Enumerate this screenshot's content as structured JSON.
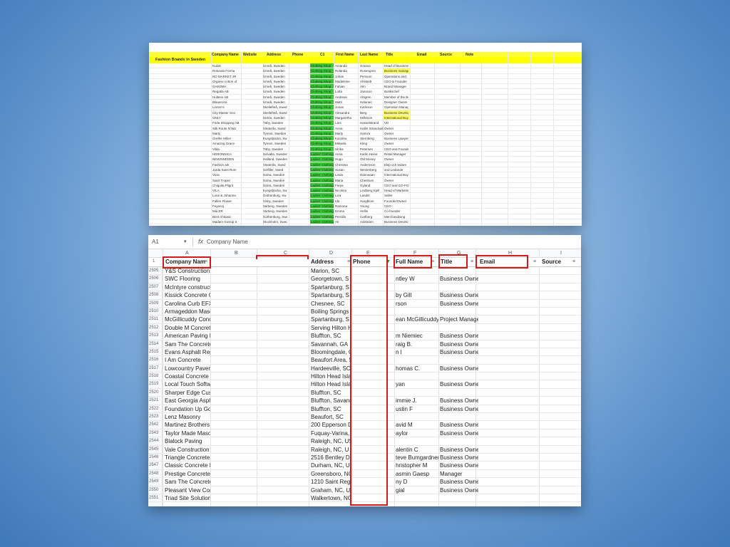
{
  "top_sheet": {
    "section_title": "Fashion Brands in Sweden",
    "headers": [
      "Company Name",
      "Website",
      "Address",
      "Phone",
      "C1",
      "First Name",
      "Last Name",
      "Title",
      "Email",
      "Source",
      "Note"
    ],
    "rows": [
      [
        "Isolde",
        "Umeå, Sweden",
        "Clothing Shop",
        "Amanda",
        "Granva",
        "Head of Business"
      ],
      [
        "Rotunda Forma",
        "Umeå, Sweden",
        "Clothing Shop",
        "Rolanda",
        "Rosengren",
        "Business manager"
      ],
      [
        "NO MARKET JR",
        "Umeå, Sweden",
        "Clothing Shop",
        "Johan",
        "Persson",
        "Operations and"
      ],
      [
        "Organic cotton of",
        "Umeå, Sweden",
        "Clothing Shop",
        "Madeleine",
        "Ahlstedt",
        "CEO & Founder"
      ],
      [
        "GAEDMA",
        "Umeå, Sweden",
        "Clothing Shop",
        "Fabian",
        "Alm",
        "Brand Manager"
      ],
      [
        "Regatta AB",
        "Umeå, Sweden",
        "Clothing Shop",
        "Lotta",
        "Jansson",
        "Butikschef"
      ],
      [
        "Hultens AB",
        "Umeå, Sweden",
        "Clothing Shop",
        "Andreas",
        "Ahlgren",
        "Member of the Board"
      ],
      [
        "Blanerona",
        "Umeå, Sweden",
        "Clothing Shop",
        "Matti",
        "Halunen",
        "Designer Owner"
      ],
      [
        "Linnen's",
        "Skellefteå, Swed",
        "Clothing Shop",
        "Jonas",
        "Karlsson",
        "Operation Manager"
      ],
      [
        "City Master Sno",
        "Skellefteå, Swed",
        "Clothing Shop",
        "Alexandra",
        "Berg",
        "Business Developer"
      ],
      [
        "ONLY",
        "Sickla, Sweden",
        "Clothing Shop",
        "Margaretha",
        "Millvison",
        "International Buyer"
      ],
      [
        "Frida Shopping AB",
        "Täby, Sweden",
        "Clothing Shop",
        "Lars",
        "Hasselstrand",
        "VD"
      ],
      [
        "Silk Route N Wa",
        "Västerås, Swed",
        "Clothing Shop",
        "Anna",
        "Hallin Strandvall",
        "Owner"
      ],
      [
        "Marty",
        "Tyresö, Sweden",
        "Clothing Shop",
        "Marty",
        "Hamza",
        "Owner"
      ],
      [
        "Grethe Hillier",
        "Kungsbacka, Sw",
        "Clothing Shop",
        "Karolina",
        "Sternberg",
        "Business Lawyer"
      ],
      [
        "Amazing Grace",
        "Tyresö, Sweden",
        "Clothing Shop",
        "Mikaela",
        "Kling",
        "Owner"
      ],
      [
        "Vilda",
        "Täby, Sweden",
        "Clothing Shop",
        "Ulrika",
        "Petersen",
        "CEO and Founder"
      ],
      [
        "HERONNICA",
        "Solvalla, Sweden",
        "Ladies' Clothing",
        "Anna",
        "Karlin Heine",
        "Retail Manager"
      ],
      [
        "NEWSWEDEN",
        "Halland, Sweden",
        "Ladies' Clothing",
        "Hugo",
        "Old Money",
        "Owner"
      ],
      [
        "Fashion ark",
        "Västerås, Swed",
        "Ladies' Clothing",
        "Christina",
        "Andersson",
        "Ekip och ledare"
      ],
      [
        "Jarda Saint Rom",
        "Solfiller, Swed",
        "Ladies' Clothing",
        "Susan",
        "Westerberg",
        "and Ledande"
      ],
      [
        "Vicia",
        "Solna, Sweden",
        "Ladies' Clothing",
        "Linda",
        "Danneaan",
        "International Buy"
      ],
      [
        "Saint Tropez",
        "Solna, Sweden",
        "Ladies' Clothing",
        "Maria",
        "Cheshum",
        "Owner"
      ],
      [
        "Chiquita Pligrit",
        "Solna, Sweden",
        "Ladies' Clothing",
        "Freya",
        "Gyland",
        "CEO and CO-FO"
      ],
      [
        "VILA",
        "Kungsbacka, Sw",
        "Ladies' Clothing",
        "Nicolina",
        "Lindberg Kjell",
        "Head of Marketing"
      ],
      [
        "Lone & Johanna",
        "Gothenburg, Sw",
        "Ladies' Clothing",
        "Liza",
        "Lander",
        "Seller"
      ],
      [
        "Fallen Flower",
        "Visby, Sweden",
        "Ladies' Clothing",
        "Ida",
        "Hargblom",
        "Founder/Owner"
      ],
      [
        "Feyenoj",
        "Varberg, Sweden",
        "Ladies' Clothing",
        "Ramona",
        "Young",
        "CEO"
      ],
      [
        "Mia ER",
        "Varberg, Sweden",
        "Ladies' Clothing",
        "Emma",
        "Hellin",
        "Co-founder"
      ],
      [
        "Best of Basic",
        "Gothenburg, Swed",
        "Ladies' Clothing",
        "Pernilla",
        "Carlberg",
        "Merchandising"
      ],
      [
        "Madam Gossip S",
        "Stockholm, Swed",
        "Ladies' Clothing",
        "Ali",
        "Adelstam",
        "Business Develo"
      ]
    ]
  },
  "formula_bar": {
    "cell_ref": "A1",
    "fx": "fx",
    "value": "Company Name"
  },
  "column_letters": [
    "A",
    "B",
    "C",
    "D",
    "E",
    "F",
    "G",
    "H",
    "I"
  ],
  "bottom_headers": {
    "company_name": "Company Nam",
    "address": "Address",
    "phone": "Phone",
    "full_name": "Full Name",
    "title": "Title",
    "email": "Email",
    "source": "Source"
  },
  "bottom_rows": [
    {
      "n": "2505",
      "company": "Y&S Construction",
      "address": "Marion, SC",
      "name": "",
      "title": ""
    },
    {
      "n": "2506",
      "company": "SWC Flooring",
      "address": "Georgetown, S",
      "name": "ntley W",
      "title": "Business Owner"
    },
    {
      "n": "2507",
      "company": "McIntyre construct",
      "address": "Spartanburg, S",
      "name": "",
      "title": ""
    },
    {
      "n": "2508",
      "company": "Kissick Concrete C",
      "address": "Spartanburg, S",
      "name": "by Gill",
      "title": "Business Owner"
    },
    {
      "n": "2509",
      "company": "Carolina Curb EFX",
      "address": "Chesnee, SC",
      "name": "rson",
      "title": "Business Owner"
    },
    {
      "n": "2510",
      "company": "Armageddon Maso",
      "address": "Boiling Springs",
      "name": "",
      "title": ""
    },
    {
      "n": "2511",
      "company": "McGillicuddy Concr",
      "address": "Spartanburg, S",
      "name": "ean McGillicuddy",
      "title": "Project Manager"
    },
    {
      "n": "2512",
      "company": "Double M Concrete",
      "address": "Serving Hilton H",
      "name": "",
      "title": ""
    },
    {
      "n": "2513",
      "company": "American Paving D",
      "address": "Bluffton, SC",
      "name": "m Niemiec",
      "title": "Business Owner"
    },
    {
      "n": "2514",
      "company": "Sam The Concrete",
      "address": "Savannah, GA",
      "name": "raig B.",
      "title": "Business Owner"
    },
    {
      "n": "2515",
      "company": "Evans Asphalt Rep",
      "address": "Bloomingdale, G",
      "name": "n l",
      "title": "Business Owner"
    },
    {
      "n": "2516",
      "company": "I Am Concrete",
      "address": "Beaufort Area, S",
      "name": "",
      "title": ""
    },
    {
      "n": "2517",
      "company": "Lowcountry Paver",
      "address": "Hardeeville, SC",
      "name": "homas C.",
      "title": "Business Owner"
    },
    {
      "n": "2518",
      "company": "Coastal Concrete F",
      "address": "Hilton Head Isla",
      "name": "",
      "title": ""
    },
    {
      "n": "2519",
      "company": "Local Touch Softw",
      "address": "Hilton Head Isla",
      "name": "yan",
      "title": "Business Owner"
    },
    {
      "n": "2520",
      "company": "Sharper Edge Cust",
      "address": "Bluffton, SC",
      "name": "",
      "title": ""
    },
    {
      "n": "2521",
      "company": "East Georgia Asph",
      "address": "Bluffton, Savann",
      "name": "immie J.",
      "title": "Business Owner"
    },
    {
      "n": "2522",
      "company": "Foundation Up Gor",
      "address": "Bluffton, SC",
      "name": "ustin F",
      "title": "Business Owner"
    },
    {
      "n": "2523",
      "company": "Lenz Masonry",
      "address": "Beaufort, SC",
      "name": "",
      "title": ""
    },
    {
      "n": "2542",
      "company": "Martinez Brothers I",
      "address": "200 Epperson D",
      "name": "avid M",
      "title": "Business Owner"
    },
    {
      "n": "2543",
      "company": "Taylor Made Mason",
      "address": "Fuquay-Varina, N",
      "name": "aylor",
      "title": "Business Owner"
    },
    {
      "n": "2544",
      "company": "Blalock Paving",
      "address": "Raleigh, NC, US",
      "name": "",
      "title": ""
    },
    {
      "n": "2545",
      "company": "Vale Construction",
      "address": "Raleigh, NC, U",
      "name": "alentin C",
      "title": "Business Owner"
    },
    {
      "n": "2546",
      "company": "Triangle Concrete",
      "address": "2516 Bentley D",
      "name": "teve Bumgardner",
      "title": "Business Owner"
    },
    {
      "n": "2547",
      "company": "Classic Concrete D",
      "address": "Durham, NC, U",
      "name": "hristopher M",
      "title": "Business Owner"
    },
    {
      "n": "2548",
      "company": "Prestige Concrete",
      "address": "Greensboro, NC",
      "name": "asmin Gaesp",
      "title": "Manager"
    },
    {
      "n": "2549",
      "company": "Sam The Concrete",
      "address": "1210 Saint Regi",
      "name": "ny D",
      "title": "Business Owner"
    },
    {
      "n": "2550",
      "company": "Pleasant View Con",
      "address": "Graham, NC, U",
      "name": "gial",
      "title": "Business Owner"
    },
    {
      "n": "2551",
      "company": "Triad Site Solutions",
      "address": "Walkertown, NC",
      "name": "",
      "title": ""
    }
  ],
  "colors": {
    "highlight_red": "#d11a1a",
    "sheet_yellow": "#ffff00",
    "category_green": "#33cc33"
  }
}
